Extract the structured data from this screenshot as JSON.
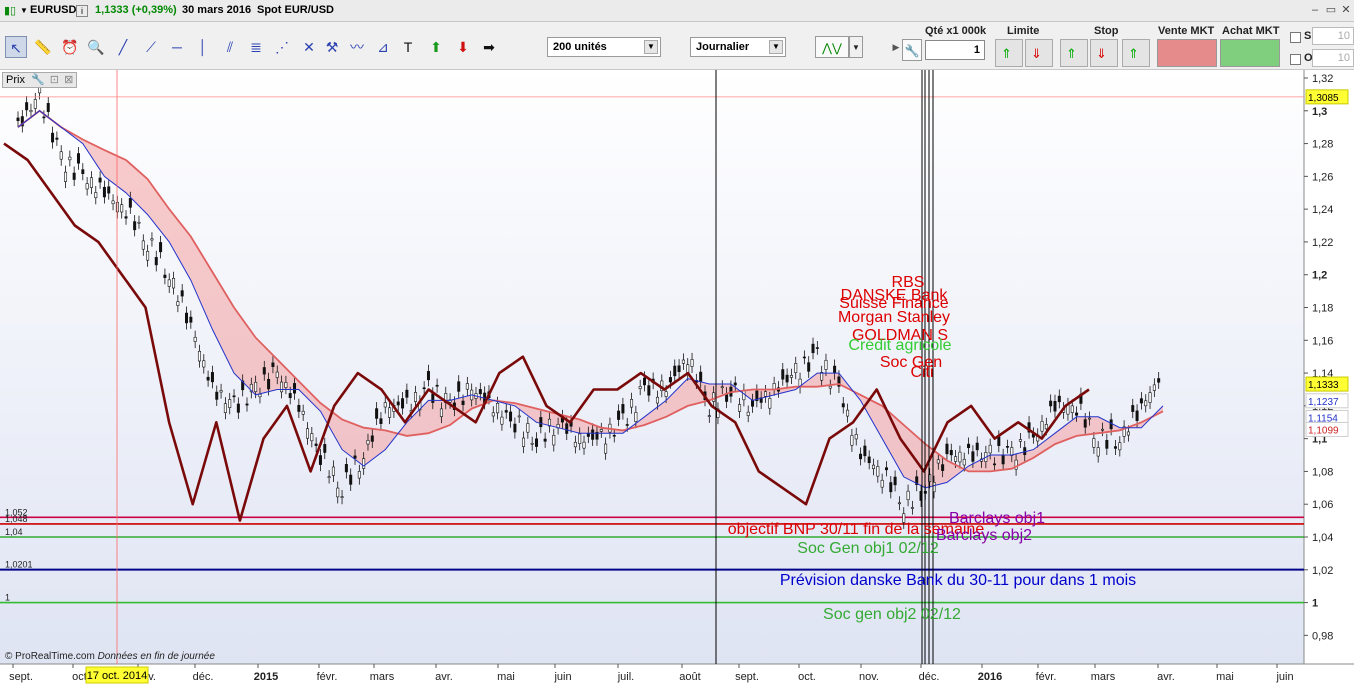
{
  "title_bar": {
    "instrument": "EURUSD",
    "info_icon": "i",
    "price": "1,1333 (+0,39%)",
    "date": "30 mars 2016",
    "name": "Spot EUR/USD"
  },
  "toolbar": {
    "units_select": "200 unités",
    "period_select": "Journalier",
    "qty_label": "Qté x1 000k",
    "qty_value": "1",
    "limit_label": "Limite",
    "stop_label": "Stop",
    "sell_label": "Vente MKT",
    "buy_label": "Achat MKT",
    "s_label": "S",
    "o_label": "O",
    "s_value": "10",
    "o_value": "10",
    "tools": [
      "pointer-icon",
      "ruler-icon",
      "alarm-icon",
      "zoom-icon",
      "line-icon",
      "segment-icon",
      "horizontal-line-icon",
      "vertical-line-icon",
      "channel-icon",
      "fibonacci-icon",
      "fan-icon",
      "cross-icon",
      "tools-icon",
      "indicator-icon",
      "triangle-icon",
      "text-icon",
      "buy-arrow-icon",
      "sell-arrow-icon",
      "right-arrow-icon"
    ]
  },
  "chart": {
    "prix_label": "Prix",
    "y_ticks": [
      "1,32",
      "1,3",
      "1,28",
      "1,26",
      "1,24",
      "1,22",
      "1,2",
      "1,18",
      "1,16",
      "1,14",
      "1,12",
      "1,1",
      "1,08",
      "1,06",
      "1,04",
      "1,02",
      "1",
      "0,98"
    ],
    "x_ticks": [
      "sept.",
      "oct.",
      "nov.",
      "déc.",
      "2015",
      "févr.",
      "mars",
      "avr.",
      "mai",
      "juin",
      "juil.",
      "août",
      "sept.",
      "oct.",
      "nov.",
      "déc.",
      "2016",
      "févr.",
      "mars",
      "avr.",
      "mai",
      "juin"
    ],
    "cursor_date": "17 oct. 2014",
    "price_tags": [
      "1,3085",
      "1,1333",
      "1,1237",
      "1,1154",
      "1,1099"
    ],
    "level_labels": [
      "1,052",
      "1,048",
      "1,04",
      "1,0201",
      "1"
    ],
    "bank_labels": [
      {
        "text": "RBS",
        "color": "#dd0000"
      },
      {
        "text": "DANSKE Bank",
        "color": "#dd0000"
      },
      {
        "text": "Suisse Finance",
        "color": "#dd0000"
      },
      {
        "text": "Morgan Stanley",
        "color": "#dd0000"
      },
      {
        "text": "GOLDMAN S",
        "color": "#dd0000"
      },
      {
        "text": "Crédit agricole",
        "color": "#33cc33"
      },
      {
        "text": "Soc Gen",
        "color": "#dd0000"
      },
      {
        "text": "Citi",
        "color": "#dd0000"
      }
    ],
    "line_labels": [
      {
        "text": "Barclays obj1",
        "color": "#8800aa"
      },
      {
        "text": "objectif BNP 30/11 fin de la semaine",
        "color": "#dd0000"
      },
      {
        "text": "Barclays obj2",
        "color": "#8800aa"
      },
      {
        "text": "Soc Gen obj1 02/12",
        "color": "#33aa33"
      },
      {
        "text": "Prévision danske Bank du 30-11 pour dans 1 mois",
        "color": "#0000cc"
      },
      {
        "text": "Soc gen obj2 02/12",
        "color": "#33aa33"
      }
    ],
    "footer_brand": "© ProRealTime.com",
    "footer_note": "Données en fin de journée"
  },
  "chart_data": {
    "type": "line",
    "ylim": [
      0.97,
      1.325
    ],
    "series": [
      {
        "name": "",
        "values": [
          1.29,
          1.31,
          1.27,
          1.26,
          1.25,
          1.24,
          1.22,
          1.2,
          1.17,
          1.13,
          1.12,
          1.13,
          1.14,
          1.12,
          1.09,
          1.07,
          1.09,
          1.12,
          1.12,
          1.13,
          1.12,
          1.13,
          1.12,
          1.11,
          1.1,
          1.11,
          1.1,
          1.1,
          1.11,
          1.13,
          1.13,
          1.15,
          1.12,
          1.13,
          1.12,
          1.13,
          1.14,
          1.15,
          1.13,
          1.09,
          1.08,
          1.06,
          1.07,
          1.09,
          1.09,
          1.09,
          1.09,
          1.1,
          1.12,
          1.12,
          1.1,
          1.1,
          1.12,
          1.14
        ]
      },
      {
        "name": "",
        "values": [
          1.28,
          1.27,
          1.25,
          1.23,
          1.22,
          1.2,
          1.18,
          1.11,
          1.06,
          1.11,
          1.05,
          1.1,
          1.12,
          1.08,
          1.12,
          1.14,
          1.13,
          1.11,
          1.13,
          1.12,
          1.11,
          1.14,
          1.15,
          1.12,
          1.11,
          1.13,
          1.13,
          1.14,
          1.13,
          1.14,
          1.12,
          1.11,
          1.08,
          1.07,
          1.06,
          1.1,
          1.11,
          1.13,
          1.1,
          1.08,
          1.11,
          1.12,
          1.1,
          1.11,
          1.1,
          1.12,
          1.13
        ]
      }
    ],
    "horizontal_levels": [
      1.052,
      1.048,
      1.04,
      1.0201,
      1
    ]
  }
}
